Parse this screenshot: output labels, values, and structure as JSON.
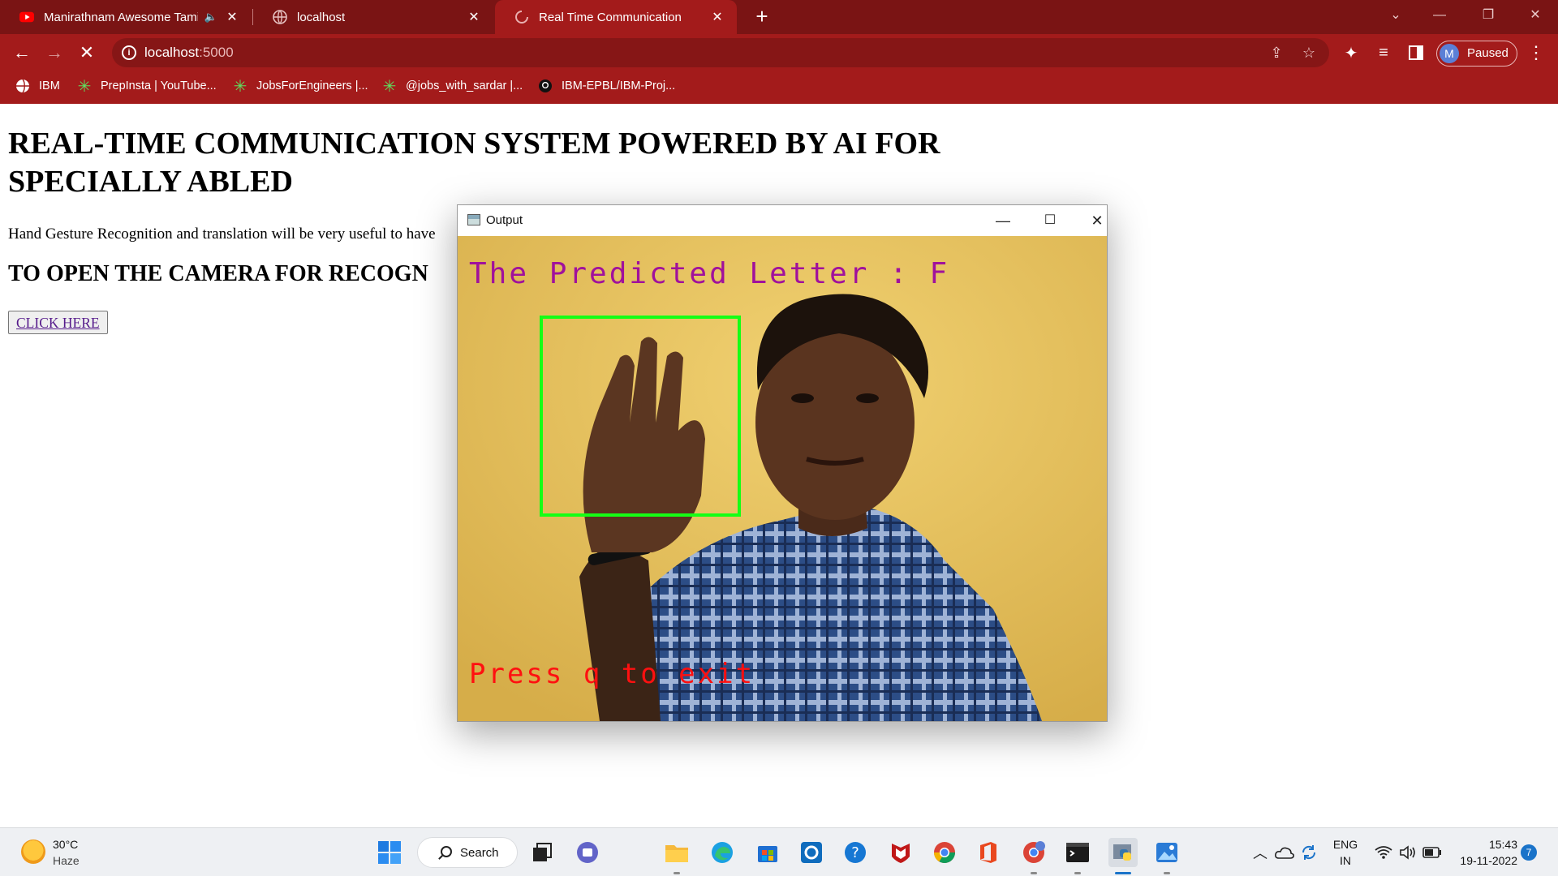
{
  "tabs": [
    {
      "title": "Manirathnam Awesome Tami",
      "icon": "youtube-icon",
      "audio": true
    },
    {
      "title": "localhost",
      "icon": "globe-icon"
    },
    {
      "title": "Real Time Communication",
      "icon": "loading-spinner-icon",
      "active": true
    }
  ],
  "address": {
    "host": "localhost",
    "port": ":5000"
  },
  "profile": {
    "initial": "M",
    "status": "Paused"
  },
  "bookmarks": [
    {
      "label": "IBM",
      "icon": "ibm-globe-icon"
    },
    {
      "label": "PrepInsta | YouTube...",
      "icon": "green-asterisk-icon"
    },
    {
      "label": "JobsForEngineers |...",
      "icon": "green-asterisk-icon"
    },
    {
      "label": "@jobs_with_sardar |...",
      "icon": "green-asterisk-icon"
    },
    {
      "label": "IBM-EPBL/IBM-Proj...",
      "icon": "github-icon"
    }
  ],
  "page": {
    "heading": "REAL-TIME COMMUNICATION SYSTEM POWERED BY AI FOR SPECIALLY ABLED",
    "description": "Hand Gesture Recognition and translation will be very useful to have",
    "subheading": "TO OPEN THE CAMERA FOR RECOGN",
    "button": "CLICK HERE"
  },
  "output_window": {
    "title": "Output",
    "predicted_text": "The Predicted Letter : F",
    "exit_hint": "Press q to exit"
  },
  "taskbar": {
    "weather": {
      "temp": "30°C",
      "condition": "Haze"
    },
    "search_label": "Search",
    "language": {
      "line1": "ENG",
      "line2": "IN"
    },
    "time": "15:43",
    "date": "19-11-2022",
    "notifications": "7"
  },
  "colors": {
    "chrome_dark": "#7a1414",
    "chrome": "#a31b1b",
    "predicted_text": "#a0119c",
    "exit_text": "#ff1010",
    "roi_box": "#15ff15"
  }
}
